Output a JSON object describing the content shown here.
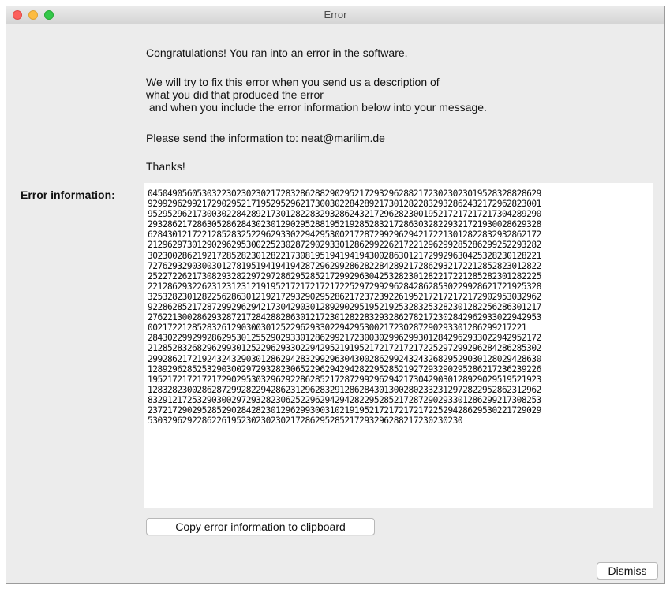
{
  "window": {
    "title": "Error"
  },
  "message": {
    "line1": "Congratulations! You ran into an error in the software.",
    "line2": "We will try to fix this error when you send us a description of\nwhat you did that produced the error\n and when you include the error information below into your message.",
    "line3": "Please send the information to: neat@marilim.de",
    "line4": "Thanks!"
  },
  "error_info": {
    "label": "Error information:",
    "text": "04504905605303223023023021728328628829029521729329628821723023023019528328828629\n92992962992172902952171952952962173003022842892173012822832932862432172962823001\n95295296217300302284289217301282283293286243217296282300195217217217217304289290\n29328621728630528628430230129029528819521928528321728630328229321721930028629328\n62843012172212852832522962933022942953002172872992962942172213012822832932862172\n21296297301290296295300225230287290293301286299226217221296299285286299252293282\n30230028621921728528230128221730819519419419430028630121729929630425328230128221\n72762932903003012781951941941942872962992862822842892172862932172212852823012822\n25227226217308293282297297286295285217299296304253282301282217221285282301282225\n22128629322623123123121919521721721721722529729929628428628530229928621721925328\n32532823012822562863012192172932902952862172372392261952172172172172902953032962\n92286285217287299296294217304290301289290295195219253283253282301282256286301217\n27622130028629328721728428828630121723012822832932862782172302842962933022942953\n00217221285283261290300301252296293302294295300217230287290293301286299217221\n28430229929928629530125529029330128629921723003029962993012842962933022942952172\n21285283268296299301252296293302294295219195217217217217225297299296284286285302\n29928621721924324329030128629428329929630430028629924324326829529030128029428630\n12892962852532903002972932823065229629429428229528521927293290295286217236239226\n19521721721721729029530329629228628521728729929629421730429030128929029519521923\n12832823002862872992822942862312962832912862843013002802332312972822952862312962\n83291217253290300297293282306252296294294282295285217287290293301286299217308253\n23721729029528529028428230129629930031021919521721721721722529428629530221729029\n5303296292286226195230230230217286295285217293296288217230230230"
  },
  "buttons": {
    "copy_label": "Copy error information to clipboard",
    "dismiss_label": "Dismiss"
  },
  "colors": {
    "close": "#fc605c",
    "minimize": "#fdbc40",
    "maximize": "#34c84a"
  }
}
